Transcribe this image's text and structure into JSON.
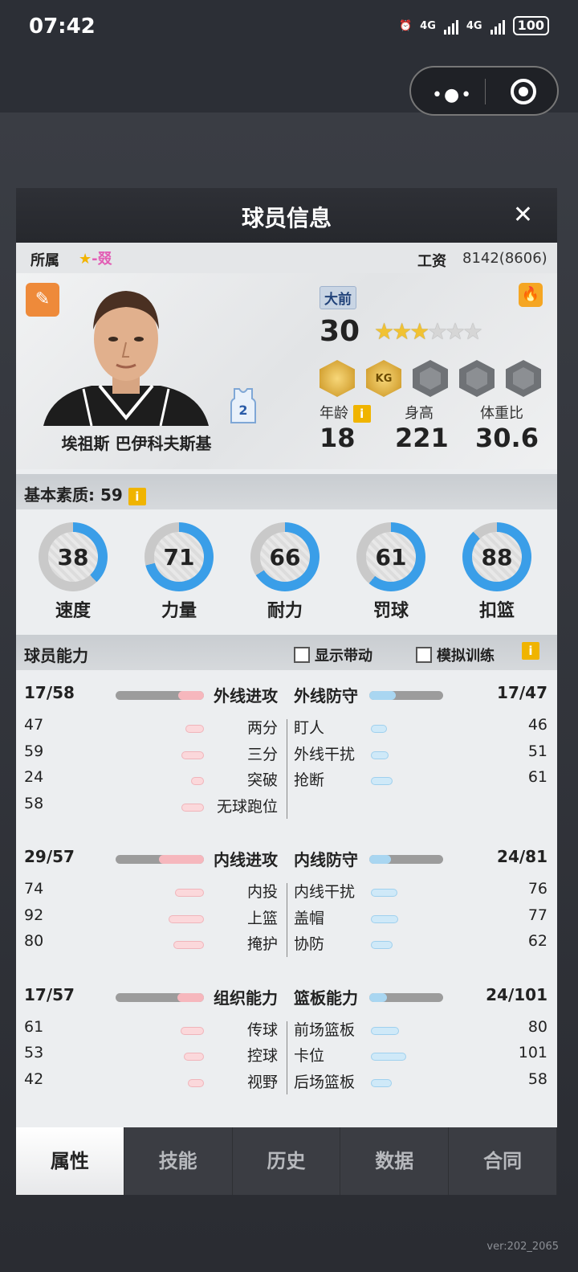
{
  "status_bar": {
    "time": "07:42",
    "battery": "100",
    "net1": "4G",
    "net2": "4G"
  },
  "dialog": {
    "title": "球员信息",
    "close_icon": "close-icon"
  },
  "affiliation": {
    "label": "所属",
    "team": "-叕",
    "salary_label": "工资",
    "salary_value": "8142(8606)"
  },
  "player": {
    "name": "埃祖斯 巴伊科夫斯基",
    "position": "大前",
    "overall": "30",
    "stars_filled": 3,
    "stars_total": 6,
    "jersey_number": "2",
    "badges": [
      {
        "text": "",
        "type": "gold"
      },
      {
        "text": "KG",
        "type": "gold"
      },
      {
        "text": "",
        "type": "grey"
      },
      {
        "text": "",
        "type": "grey"
      },
      {
        "text": "",
        "type": "grey"
      }
    ],
    "age_label": "年龄",
    "age": "18",
    "height_label": "身高",
    "height": "221",
    "weight_label": "体重比",
    "weight": "30.6"
  },
  "basic": {
    "label": "基本素质: 59",
    "stats": [
      {
        "label": "速度",
        "value": 38
      },
      {
        "label": "力量",
        "value": 71
      },
      {
        "label": "耐力",
        "value": 66
      },
      {
        "label": "罚球",
        "value": 61
      },
      {
        "label": "扣篮",
        "value": 88
      }
    ]
  },
  "abilities": {
    "label": "球员能力",
    "show_boost": "显示带动",
    "sim_train": "模拟训练",
    "groups": [
      {
        "left": {
          "name": "外线进攻",
          "value": "17/58",
          "cur": 17,
          "max": 58
        },
        "right": {
          "name": "外线防守",
          "value": "17/47",
          "cur": 17,
          "max": 47
        },
        "left_items": [
          {
            "name": "两分",
            "value": "47"
          },
          {
            "name": "三分",
            "value": "59"
          },
          {
            "name": "突破",
            "value": "24"
          },
          {
            "name": "无球跑位",
            "value": "58"
          }
        ],
        "right_items": [
          {
            "name": "盯人",
            "value": "46"
          },
          {
            "name": "外线干扰",
            "value": "51"
          },
          {
            "name": "抢断",
            "value": "61"
          }
        ]
      },
      {
        "left": {
          "name": "内线进攻",
          "value": "29/57",
          "cur": 29,
          "max": 57
        },
        "right": {
          "name": "内线防守",
          "value": "24/81",
          "cur": 24,
          "max": 81
        },
        "left_items": [
          {
            "name": "内投",
            "value": "74"
          },
          {
            "name": "上篮",
            "value": "92"
          },
          {
            "name": "掩护",
            "value": "80"
          }
        ],
        "right_items": [
          {
            "name": "内线干扰",
            "value": "76"
          },
          {
            "name": "盖帽",
            "value": "77"
          },
          {
            "name": "协防",
            "value": "62"
          }
        ]
      },
      {
        "left": {
          "name": "组织能力",
          "value": "17/57",
          "cur": 17,
          "max": 57
        },
        "right": {
          "name": "篮板能力",
          "value": "24/101",
          "cur": 24,
          "max": 101
        },
        "left_items": [
          {
            "name": "传球",
            "value": "61"
          },
          {
            "name": "控球",
            "value": "53"
          },
          {
            "name": "视野",
            "value": "42"
          }
        ],
        "right_items": [
          {
            "name": "前场篮板",
            "value": "80"
          },
          {
            "name": "卡位",
            "value": "101"
          },
          {
            "name": "后场篮板",
            "value": "58"
          }
        ]
      }
    ]
  },
  "tabs": [
    "属性",
    "技能",
    "历史",
    "数据",
    "合同"
  ],
  "active_tab": 0,
  "version": "ver:202_2065",
  "colors": {
    "ring_blue": "#3a9ee8",
    "ring_grey": "#c9c9c9",
    "accent_gold": "#f0b400"
  }
}
